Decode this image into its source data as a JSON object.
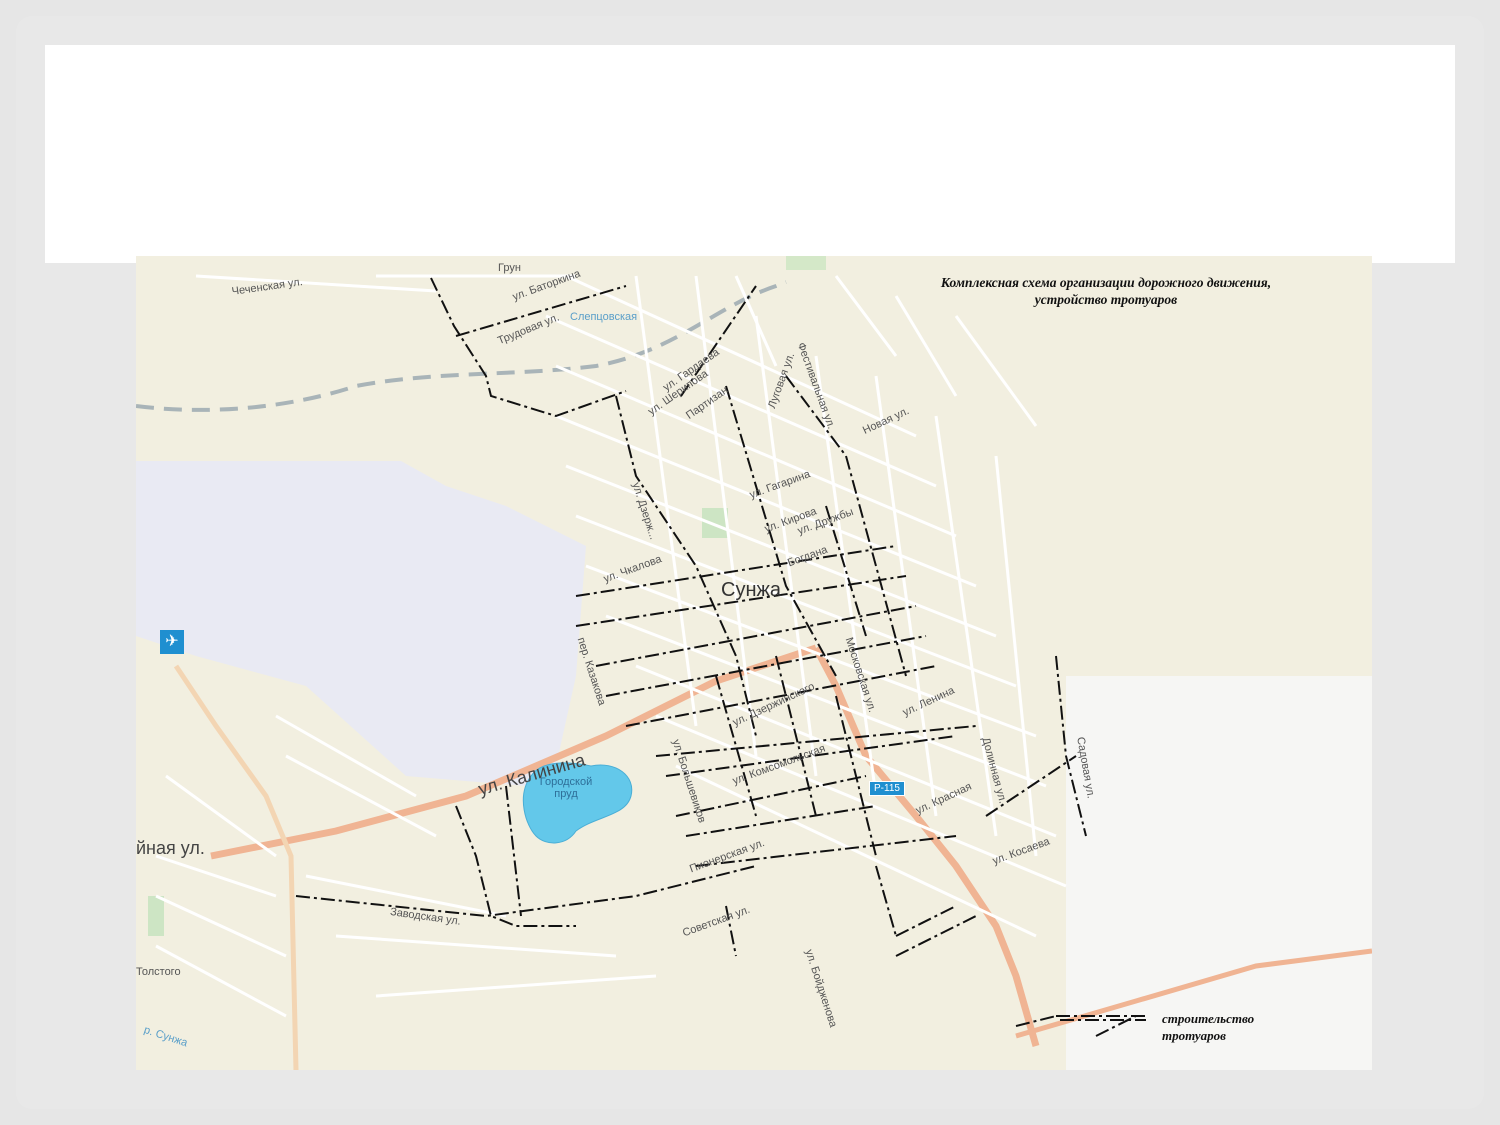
{
  "slide": {
    "title_box": ""
  },
  "map": {
    "title_line1": "Комплексная схема организации дорожного движения,",
    "title_line2": "устройство тротуаров",
    "city": "Сунжа",
    "pond_line1": "Городской",
    "pond_line2": "пруд",
    "road_badge": "Р-115",
    "airport_icon": "airplane-icon",
    "legend_label_line1": "строительство",
    "legend_label_line2": "тротуаров",
    "streets": {
      "kalinina": "ул. Калинина",
      "chechenskaya": "Чеченская ул.",
      "batorskaya": "ул. Баторкина",
      "grun": "Грун",
      "sluts": "Слепцовская",
      "trudovaya": "Трудовая ул.",
      "gardaev": "ул. Гардаева",
      "shepteeva": "ул. Шерипова",
      "partizanskaya": "Партизан",
      "lugovaya": "Луговая ул.",
      "festivalnaya": "Фестивальная ул.",
      "novaya": "Новая ул.",
      "gagarina": "ул. Гагарина",
      "kirova": "ул. Кирова",
      "druzhby": "ул. Дружбы",
      "bogdan": "Богдана",
      "chkalova": "ул. Чкалова",
      "dzerzh_vert": "ул. Дзерж...",
      "kazakhova": "пер. Казакова",
      "dzerzhinskogo": "ул. Дзержинского",
      "lenina": "ул. Ленина",
      "moskovskaya": "Московская ул.",
      "krasnaya": "ул. Красная",
      "kosaeva": "ул. Косаева",
      "dolinnaya": "Долинная ул.",
      "sadovaya": "Садовая ул.",
      "pionerskaya": "Пионерская ул.",
      "sovetskaya": "Советская ул.",
      "zavodskaya": "Заводская ул.",
      "bokovaya": "ул. Бойдженова",
      "ynaya": "йная ул.",
      "tolstogo": "Толстого",
      "sunzha_river": "р. Сунжа",
      "bolshaya": "ул. Большевиков",
      "komsomol": "ул. Комсомольская"
    }
  }
}
